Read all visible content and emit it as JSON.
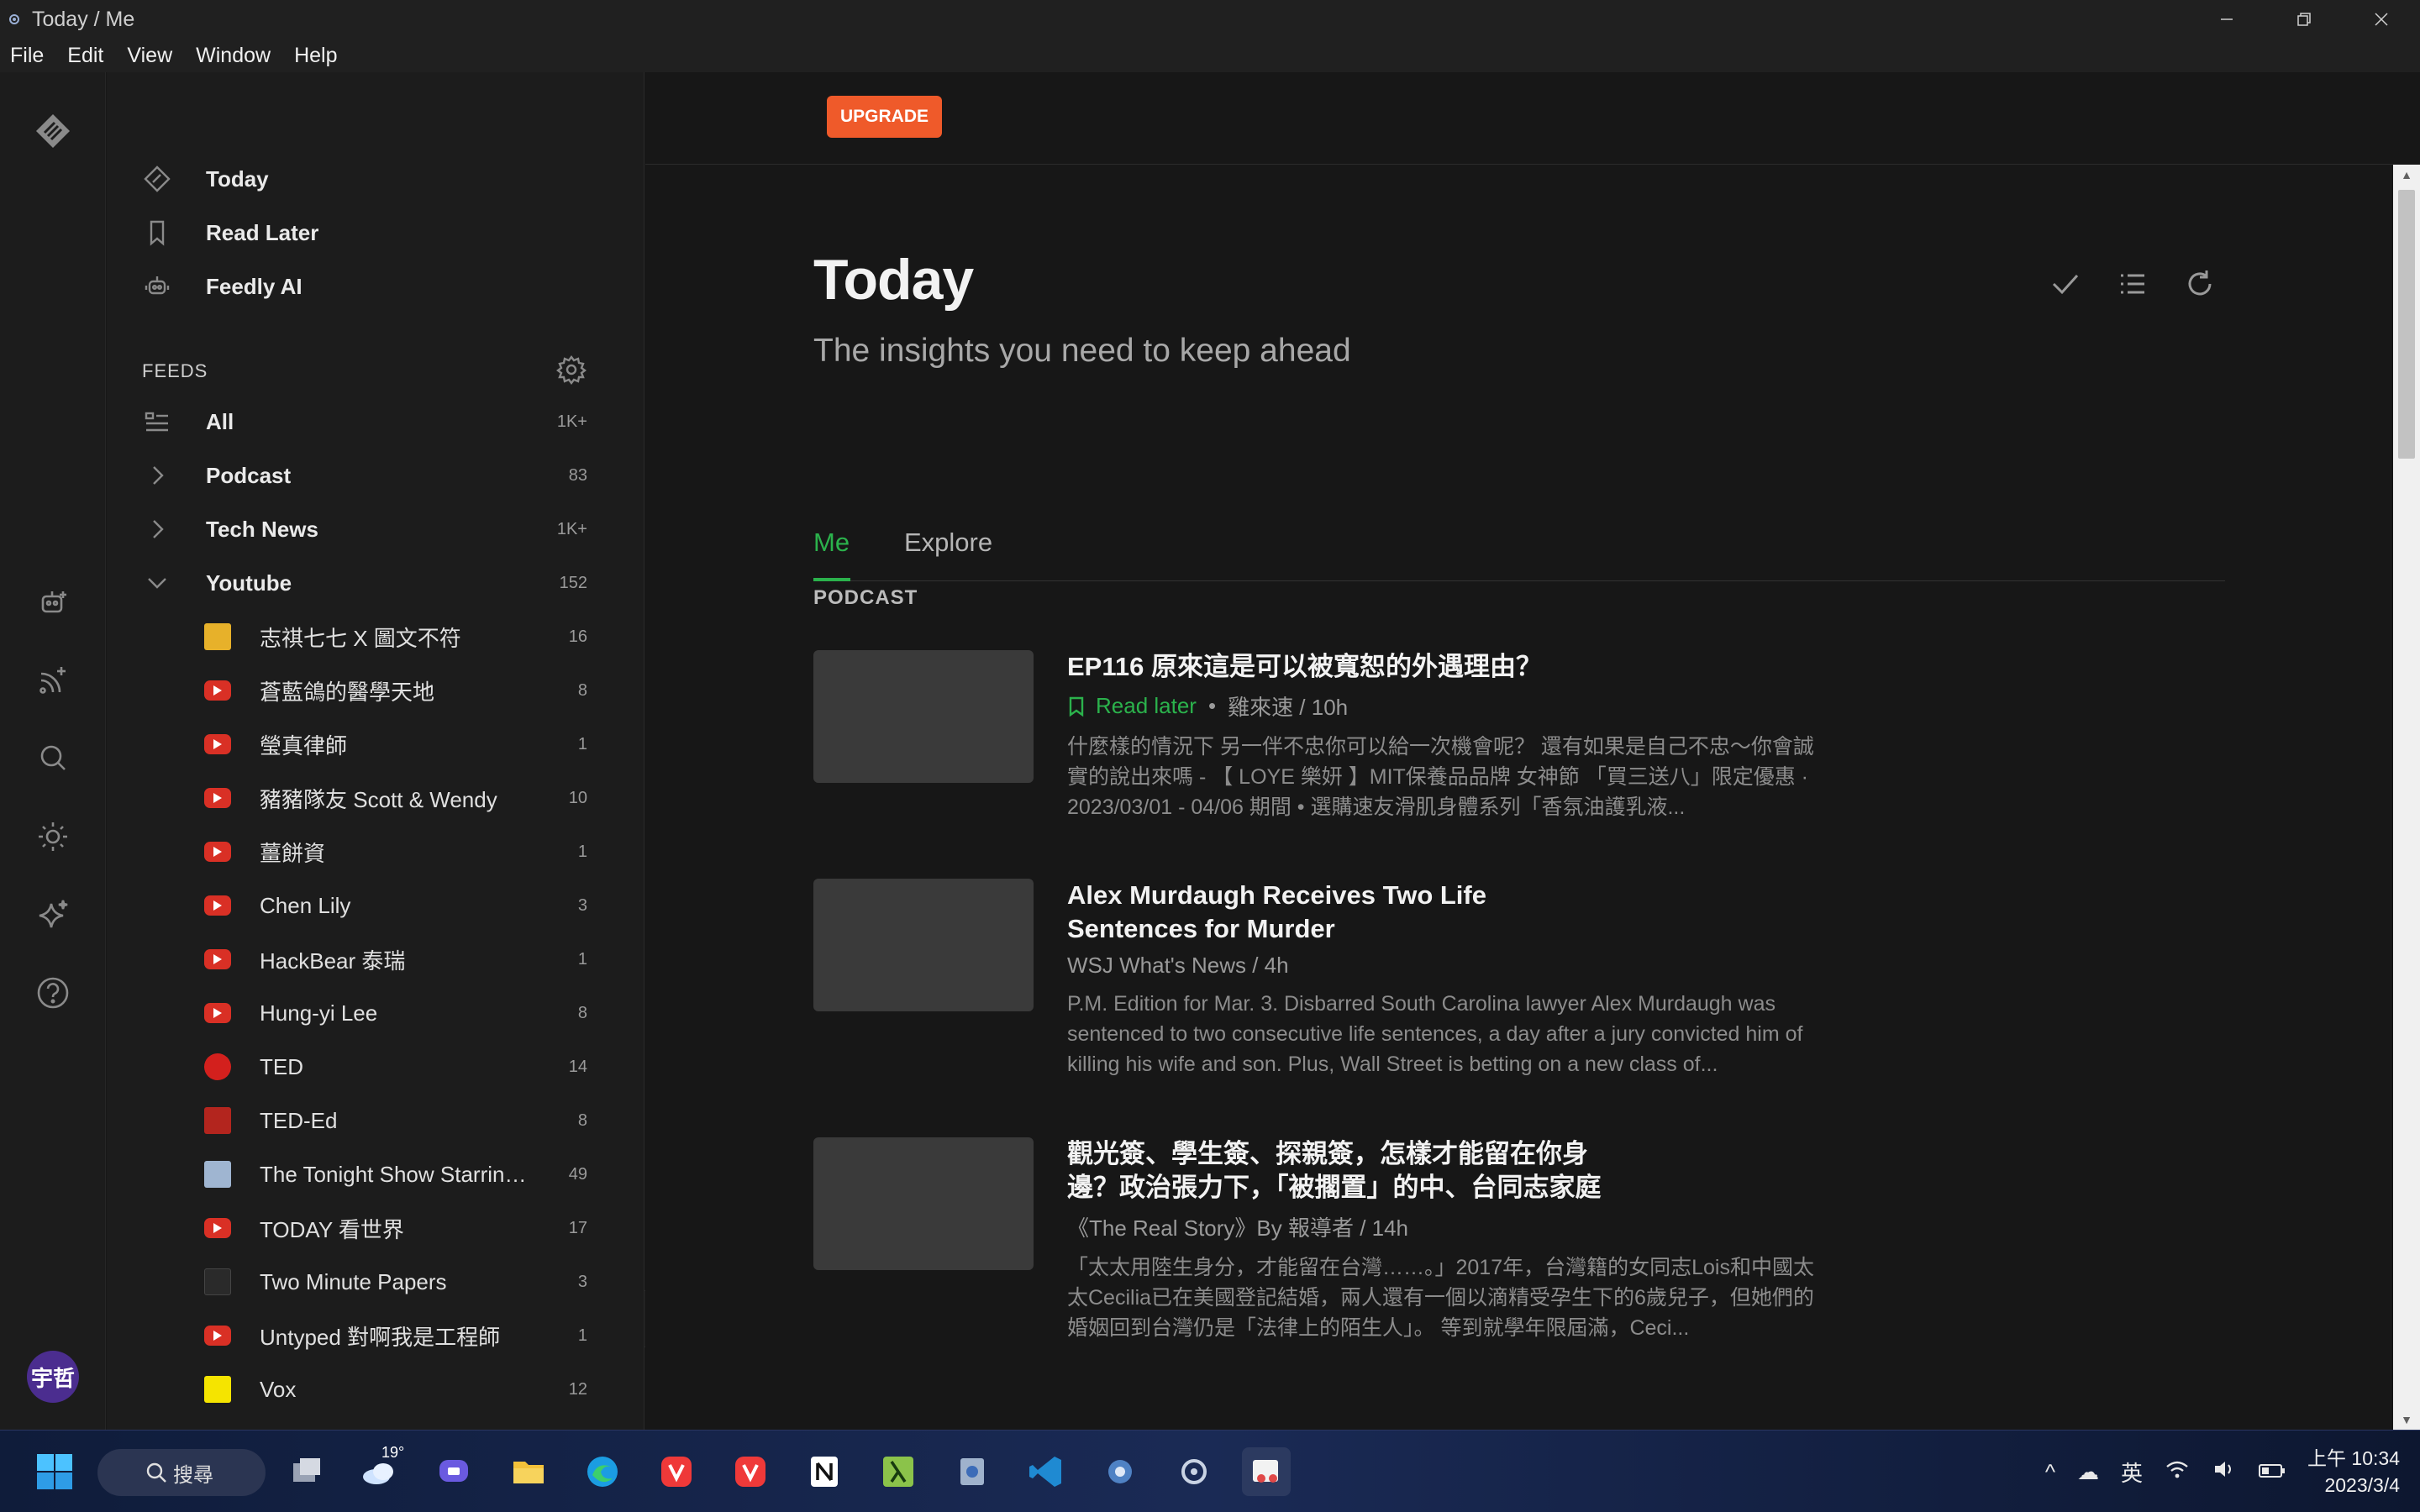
{
  "window": {
    "title": "Today / Me",
    "menu": [
      "File",
      "Edit",
      "View",
      "Window",
      "Help"
    ]
  },
  "rail": {
    "avatar_text": "宇哲"
  },
  "sidebar": {
    "nav": [
      {
        "label": "Today",
        "icon": "feedly-diamond-icon"
      },
      {
        "label": "Read Later",
        "icon": "bookmark-icon"
      },
      {
        "label": "Feedly AI",
        "icon": "robot-icon"
      }
    ],
    "feeds_header": "FEEDS",
    "feeds": [
      {
        "label": "All",
        "count": "1K+",
        "icon": "list-icon"
      },
      {
        "label": "Podcast",
        "count": "83",
        "icon": "chevron-right-icon"
      },
      {
        "label": "Tech News",
        "count": "1K+",
        "icon": "chevron-right-icon"
      },
      {
        "label": "Youtube",
        "count": "152",
        "icon": "chevron-down-icon"
      }
    ],
    "youtube_subs": [
      {
        "label": "志祺七七 X 圖文不符",
        "count": "16",
        "fav": "yellow"
      },
      {
        "label": "蒼藍鴿的醫學天地",
        "count": "8",
        "fav": "yt"
      },
      {
        "label": "瑩真律師",
        "count": "1",
        "fav": "yt"
      },
      {
        "label": "豬豬隊友 Scott & Wendy",
        "count": "10",
        "fav": "yt"
      },
      {
        "label": "薑餅資",
        "count": "1",
        "fav": "yt"
      },
      {
        "label": "Chen Lily",
        "count": "3",
        "fav": "yt"
      },
      {
        "label": "HackBear 泰瑞",
        "count": "1",
        "fav": "yt"
      },
      {
        "label": "Hung-yi Lee",
        "count": "8",
        "fav": "yt"
      },
      {
        "label": "TED",
        "count": "14",
        "fav": "ted"
      },
      {
        "label": "TED-Ed",
        "count": "8",
        "fav": "tededu"
      },
      {
        "label": "The Tonight Show Starrin…",
        "count": "49",
        "fav": "tonight"
      },
      {
        "label": "TODAY 看世界",
        "count": "17",
        "fav": "yt"
      },
      {
        "label": "Two Minute Papers",
        "count": "3",
        "fav": "tmp"
      },
      {
        "label": "Untyped 對啊我是工程師",
        "count": "1",
        "fav": "yt"
      },
      {
        "label": "Vox",
        "count": "12",
        "fav": "vox"
      }
    ]
  },
  "main": {
    "upgrade_label": "UPGRADE",
    "title": "Today",
    "subtitle": "The insights you need to keep ahead",
    "tabs": [
      {
        "label": "Me",
        "active": true
      },
      {
        "label": "Explore",
        "active": false
      }
    ],
    "section": "PODCAST",
    "articles": [
      {
        "title": "EP116 原來這是可以被寬恕的外遇理由？",
        "read_later": "Read later",
        "source": "雞來速 / 10h",
        "desc": "什麼樣的情況下 另一伴不忠你可以給一次機會呢？ 還有如果是自己不忠～你會誠實的說出來嗎 - 【 LOYE 樂妍 】MIT保養品品牌 女神節 「買三送八」限定優惠 · 2023/03/01 - 04/06 期間 • 選購速友滑肌身體系列「香氛油護乳液..."
      },
      {
        "title": "Alex Murdaugh Receives Two Life Sentences for Murder",
        "read_later": "",
        "source": "WSJ What's News / 4h",
        "desc": "P.M. Edition for Mar. 3. Disbarred South Carolina lawyer Alex Murdaugh was sentenced to two consecutive life sentences, a day after a jury convicted him of killing his wife and son. Plus, Wall Street is betting on a new class of..."
      },
      {
        "title": "觀光簽、學生簽、探親簽，怎樣才能留在你身邊？政治張力下，「被擱置」的中、台同志家庭",
        "read_later": "",
        "source": "《The Real Story》By 報導者 / 14h",
        "desc": "「太太用陸生身分，才能留在台灣……。」2017年，台灣籍的女同志Lois和中國太太Cecilia已在美國登記結婚，兩人還有一個以滴精受孕生下的6歲兒子，但她們的婚姻回到台灣仍是「法律上的陌生人」。 等到就學年限屆滿，Ceci..."
      }
    ]
  },
  "taskbar": {
    "search_label": "搜尋",
    "weather": "19°",
    "ime": "英",
    "time": "上午 10:34",
    "date": "2023/3/4"
  },
  "colors": {
    "accent_green": "#2bb24c",
    "upgrade_orange": "#ef5a2a"
  }
}
